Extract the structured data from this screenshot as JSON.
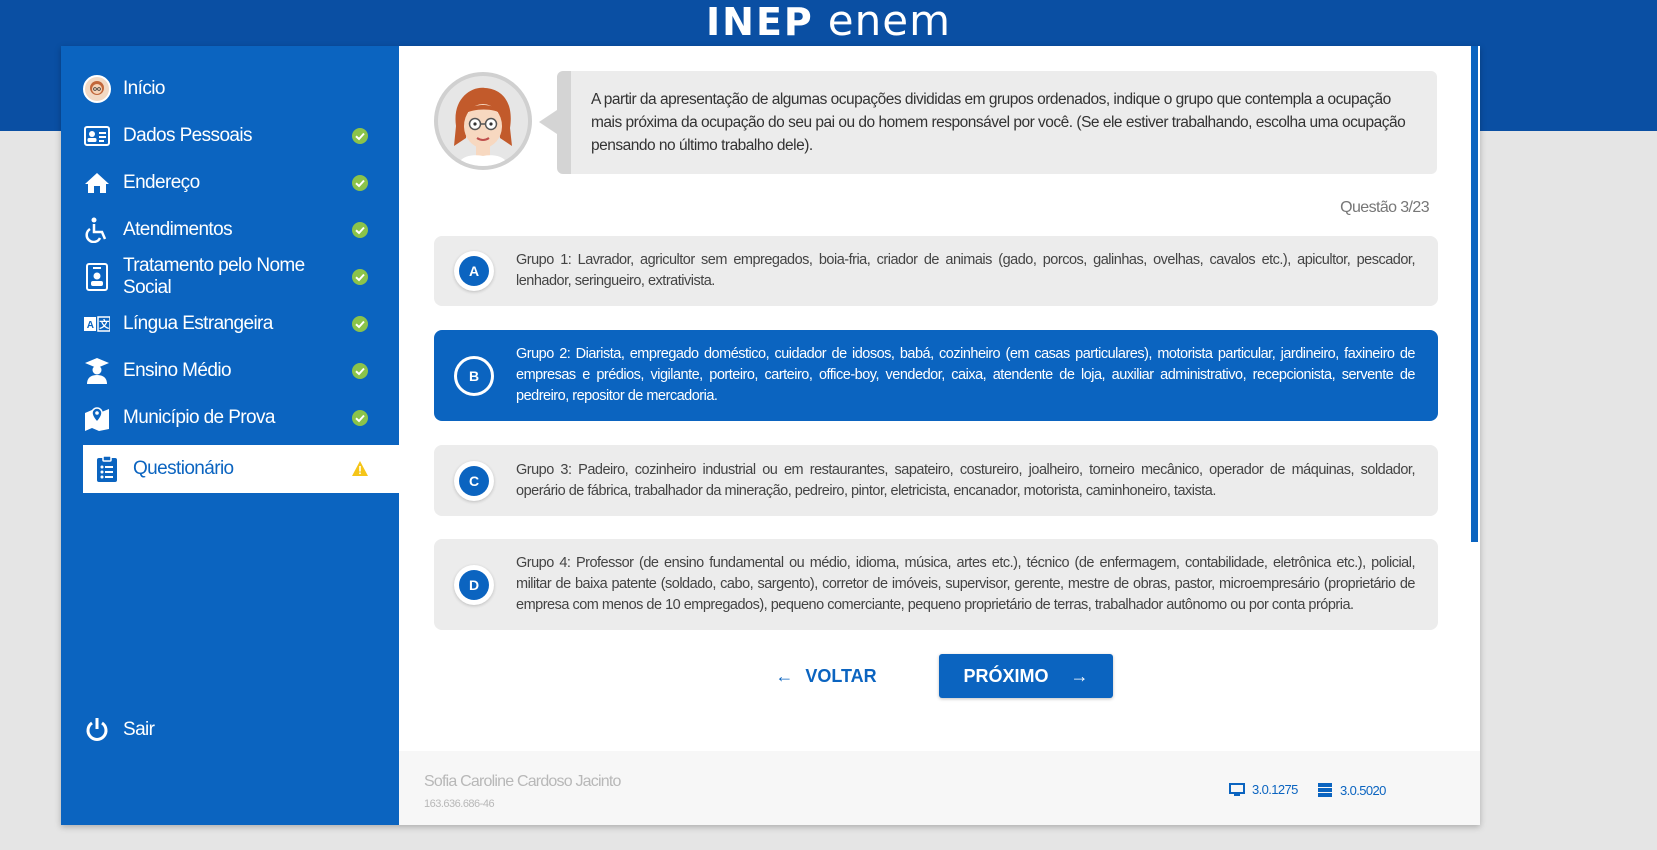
{
  "logo": {
    "inep": "INEP",
    "enem": "enem"
  },
  "sidebar": {
    "items": [
      {
        "label": "Início",
        "icon": "user-avatar-icon",
        "status": ""
      },
      {
        "label": "Dados Pessoais",
        "icon": "id-card-icon",
        "status": "check"
      },
      {
        "label": "Endereço",
        "icon": "home-icon",
        "status": "check"
      },
      {
        "label": "Atendimentos",
        "icon": "wheelchair-icon",
        "status": "check"
      },
      {
        "label": "Tratamento pelo Nome Social",
        "icon": "badge-icon",
        "status": "check"
      },
      {
        "label": "Língua Estrangeira",
        "icon": "translate-icon",
        "status": "check"
      },
      {
        "label": "Ensino Médio",
        "icon": "graduate-icon",
        "status": "check"
      },
      {
        "label": "Município de Prova",
        "icon": "map-pin-icon",
        "status": "check"
      },
      {
        "label": "Questionário",
        "icon": "clipboard-icon",
        "status": "warning"
      }
    ],
    "logout": "Sair"
  },
  "question": {
    "text": "A partir da apresentação de algumas ocupações divididas em grupos ordenados, indique o grupo que contempla a ocupação mais próxima da ocupação do seu pai ou do homem responsável por você. (Se ele estiver trabalhando, escolha uma ocupação pensando no último trabalho dele).",
    "counter": "Questão 3/23"
  },
  "options": [
    {
      "letter": "A",
      "text": "Grupo 1: Lavrador, agricultor sem empregados, boia-fria, criador de animais (gado, porcos, galinhas, ovelhas, cavalos etc.), apicultor, pescador, lenhador, seringueiro, extrativista.",
      "selected": false
    },
    {
      "letter": "B",
      "text": "Grupo 2: Diarista, empregado doméstico, cuidador de idosos, babá, cozinheiro (em casas particulares), motorista particular, jardineiro, faxineiro de empresas e prédios, vigilante, porteiro, carteiro, office-boy, vendedor, caixa, atendente de loja, auxiliar administrativo, recepcionista, servente de pedreiro, repositor de mercadoria.",
      "selected": true
    },
    {
      "letter": "C",
      "text": "Grupo 3: Padeiro, cozinheiro industrial ou em restaurantes, sapateiro, costureiro, joalheiro, torneiro mecânico, operador de máquinas, soldador, operário de fábrica, trabalhador da mineração, pedreiro, pintor, eletricista, encanador, motorista, caminhoneiro, taxista.",
      "selected": false
    },
    {
      "letter": "D",
      "text": "Grupo 4: Professor (de ensino fundamental ou médio, idioma, música, artes etc.), técnico (de enfermagem, contabilidade, eletrônica etc.), policial, militar de baixa patente (soldado, cabo, sargento), corretor de imóveis, supervisor, gerente, mestre de obras, pastor, microempresário (proprietário de empresa com menos de 10 empregados), pequeno comerciante, pequeno proprietário de terras, trabalhador autônomo ou por conta própria.",
      "selected": false
    }
  ],
  "buttons": {
    "back": "VOLTAR",
    "next": "PRÓXIMO"
  },
  "footer": {
    "user_name": "Sofia Caroline Cardoso Jacinto",
    "user_cpf": "163.636.686-46",
    "client_version": "3.0.1275",
    "server_version": "3.0.5020"
  },
  "colors": {
    "primary": "#0b64c0",
    "header": "#0a4fa3",
    "check": "#8bc34a",
    "warning": "#f5c518"
  }
}
